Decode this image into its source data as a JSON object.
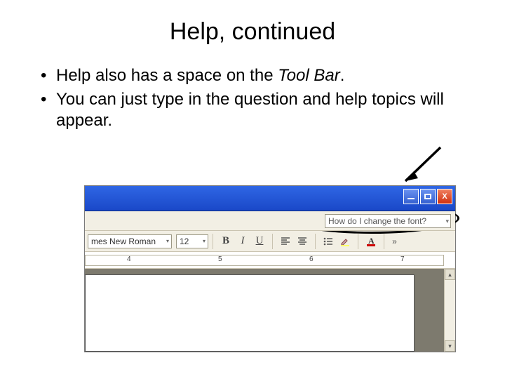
{
  "title": "Help, continued",
  "bullets": [
    {
      "pre": "Help also has a space on the ",
      "em": "Tool Bar",
      "post": "."
    },
    {
      "pre": "You can just type in the question and help topics will appear.",
      "em": "",
      "post": ""
    }
  ],
  "shot": {
    "help_query": "How do I change the font?",
    "font_name": "mes New Roman",
    "font_size": "12",
    "b": "B",
    "i": "I",
    "u": "U",
    "more": "»",
    "ruler_numbers": [
      "4",
      "5",
      "6",
      "7"
    ],
    "winbtns": {
      "close": "X"
    }
  }
}
